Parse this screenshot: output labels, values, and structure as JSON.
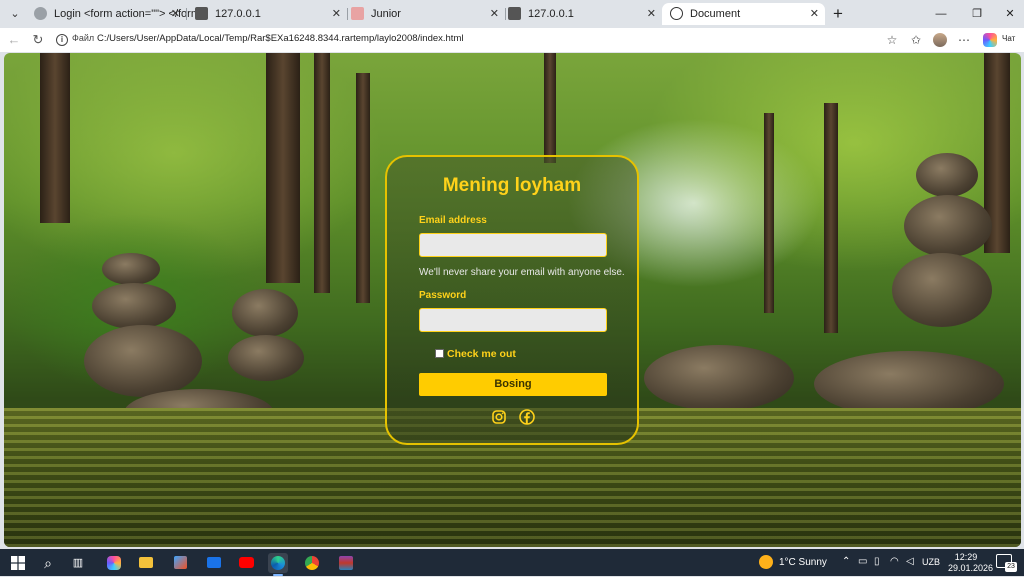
{
  "tabs": [
    {
      "label": "Login <form action=\"\"> </form>",
      "icon": "globe-icon"
    },
    {
      "label": "127.0.0.1",
      "icon": "server-icon"
    },
    {
      "label": "Junior",
      "icon": "page-icon"
    },
    {
      "label": "127.0.0.1",
      "icon": "server-icon"
    },
    {
      "label": "Document",
      "icon": "globe-icon",
      "active": true
    }
  ],
  "address": {
    "scheme_label": "Файл",
    "url": "C:/Users/User/AppData/Local/Temp/Rar$EXa16248.8344.rartemp/laylo2008/index.html",
    "chat_label": "Чат"
  },
  "form": {
    "title": "Mening loyham",
    "email_label": "Email address",
    "email_value": "",
    "help_text": "We'll never share your email with anyone else.",
    "password_label": "Password",
    "password_value": "",
    "checkbox_label": "Check me out",
    "submit_label": "Bosing",
    "social_icons": [
      "instagram-icon",
      "facebook-icon"
    ],
    "accent_color": "#ffd21a"
  },
  "taskbar": {
    "weather": "1°C  Sunny",
    "language": "UZB",
    "time": "12:29",
    "date": "29.01.2026",
    "notifications": "23"
  }
}
